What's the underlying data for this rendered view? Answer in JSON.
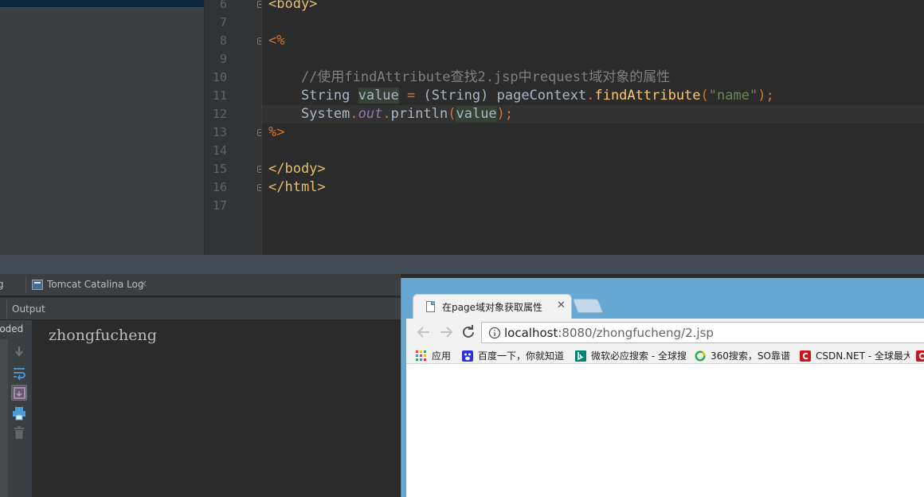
{
  "editor": {
    "lines": [
      {
        "num": "6",
        "seg": [
          {
            "t": "<body>",
            "c": "tag"
          }
        ]
      },
      {
        "num": "7",
        "seg": []
      },
      {
        "num": "8",
        "seg": [
          {
            "t": "<%",
            "c": "jsp"
          }
        ]
      },
      {
        "num": "9",
        "seg": []
      },
      {
        "num": "10",
        "seg": [
          {
            "t": "    //使用findAttribute查找2.jsp中request域对象的属性",
            "c": "cmt"
          }
        ]
      },
      {
        "num": "11",
        "seg": [
          {
            "t": "    String ",
            "c": ""
          },
          {
            "t": "value",
            "c": "var"
          },
          {
            "t": " = ",
            "c": "jsp"
          },
          {
            "t": "(String) ",
            "c": ""
          },
          {
            "t": "pageContext",
            "c": ""
          },
          {
            "t": ".",
            "c": "jsp"
          },
          {
            "t": "findAttribute",
            "c": "mth"
          },
          {
            "t": "(",
            "c": "jsp"
          },
          {
            "t": "\"name\"",
            "c": "str"
          },
          {
            "t": ");",
            "c": "jsp"
          }
        ]
      },
      {
        "num": "12",
        "seg": [
          {
            "t": "    System",
            "c": ""
          },
          {
            "t": ".",
            "c": "jsp"
          },
          {
            "t": "out",
            "c": "fld"
          },
          {
            "t": ".",
            "c": "jsp"
          },
          {
            "t": "println",
            "c": ""
          },
          {
            "t": "(",
            "c": "jsp"
          },
          {
            "t": "value",
            "c": "var"
          },
          {
            "t": ");",
            "c": "jsp"
          }
        ]
      },
      {
        "num": "13",
        "seg": [
          {
            "t": "%>",
            "c": "jsp"
          }
        ]
      },
      {
        "num": "14",
        "seg": []
      },
      {
        "num": "15",
        "seg": [
          {
            "t": "</body>",
            "c": "tag"
          }
        ]
      },
      {
        "num": "16",
        "seg": [
          {
            "t": "</html>",
            "c": "tag"
          }
        ]
      },
      {
        "num": "17",
        "seg": []
      }
    ],
    "active_line_index": 6
  },
  "bottom_panel": {
    "tab_fragment": "g",
    "tab_label": "Tomcat Catalina Log",
    "tab_close": "×",
    "output_label": "Output",
    "deploy_fragment": "loded",
    "console_output": "zhongfucheng"
  },
  "browser": {
    "tab_title": "在page域对象获取属性",
    "tab_close": "✕",
    "url_host": "localhost",
    "url_rest": ":8080/zhongfucheng/2.jsp",
    "bookmarks": [
      {
        "label": "应用",
        "icon": "apps-grid-icon"
      },
      {
        "label": "百度一下，你就知道",
        "icon": "baidu-icon",
        "color": "#2932e1"
      },
      {
        "label": "微软必应搜索 - 全球搜",
        "icon": "bing-icon",
        "color": "#008373"
      },
      {
        "label": "360搜索，SO靠谱",
        "icon": "so360-icon",
        "color": "#1fb141"
      },
      {
        "label": "CSDN.NET - 全球最大",
        "icon": "csdn-icon",
        "color": "#c9171e"
      }
    ]
  }
}
